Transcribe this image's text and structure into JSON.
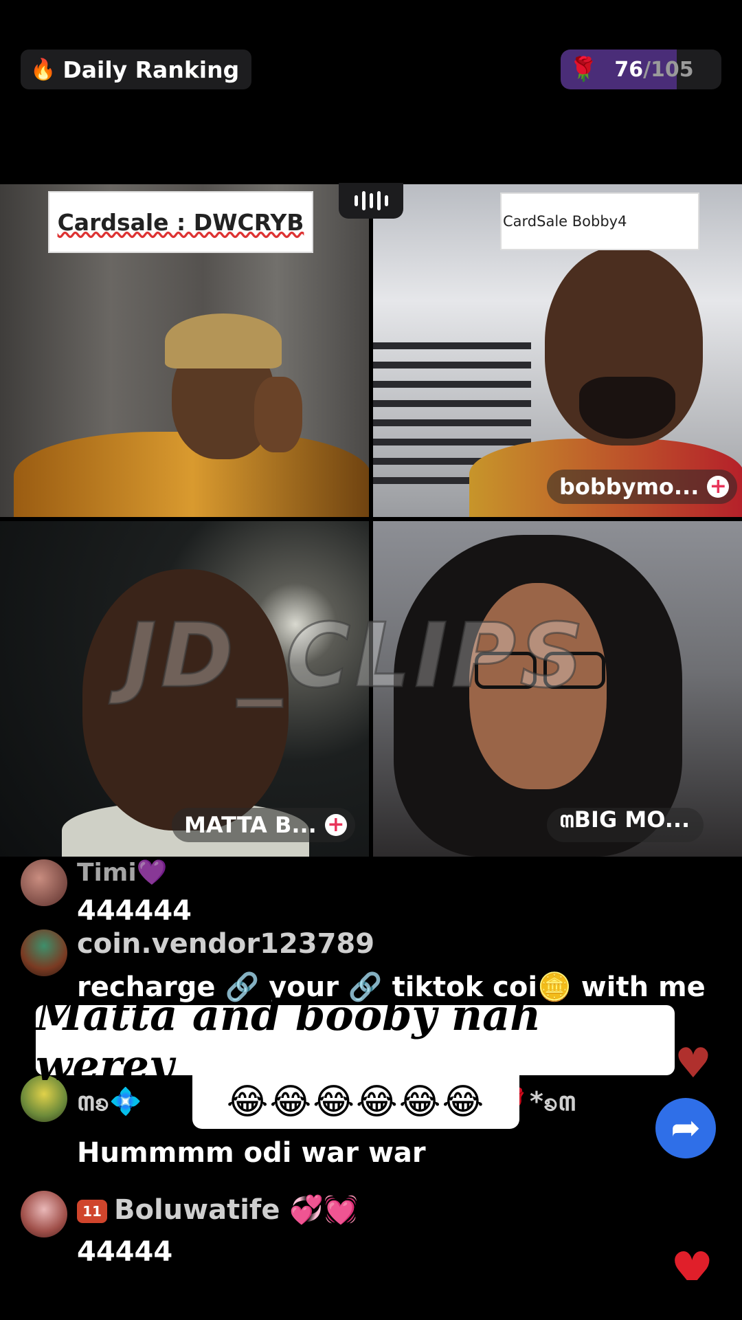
{
  "header": {
    "daily_ranking_label": "Daily Ranking",
    "rank_current": "76",
    "rank_total": "/105",
    "rank_fraction": 0.724
  },
  "tiles": {
    "tile1_banner": "Cardsale : DWCRYB",
    "tile2_banner": "CardSale Bobby4",
    "tile2_name": "bobbymo...",
    "tile3_name": "MATTA B...",
    "tile4_name": "꧟BIG MO..."
  },
  "watermark": "JD_CLIPS",
  "chat": [
    {
      "user": "Timi💜",
      "message": "444444"
    },
    {
      "user": "coin.vendor123789",
      "message": "recharge 🔗 your 🔗 tiktok coi🪙 with me"
    },
    {
      "user": "꧟ꧠ💠",
      "user_tail": "🌷🌹*ꧠ꧟",
      "message": "Hummmm odi war war"
    },
    {
      "user": "Boluwatife 💞💓",
      "badge": "11",
      "message": "44444"
    }
  ],
  "captions": {
    "line1": "Matta and booby nah werey",
    "line2": "😂😂😂😂😂😂"
  },
  "icons": {
    "flame": "flame-icon",
    "rose": "rose-icon",
    "layout": "grid-layout-icon",
    "share": "share-icon",
    "heart": "heart-icon"
  },
  "colors": {
    "rank_fill": "#4a2d78",
    "share_button": "#2f6fe8",
    "plus_accent": "#e8345a",
    "heart": "#b0302d"
  }
}
